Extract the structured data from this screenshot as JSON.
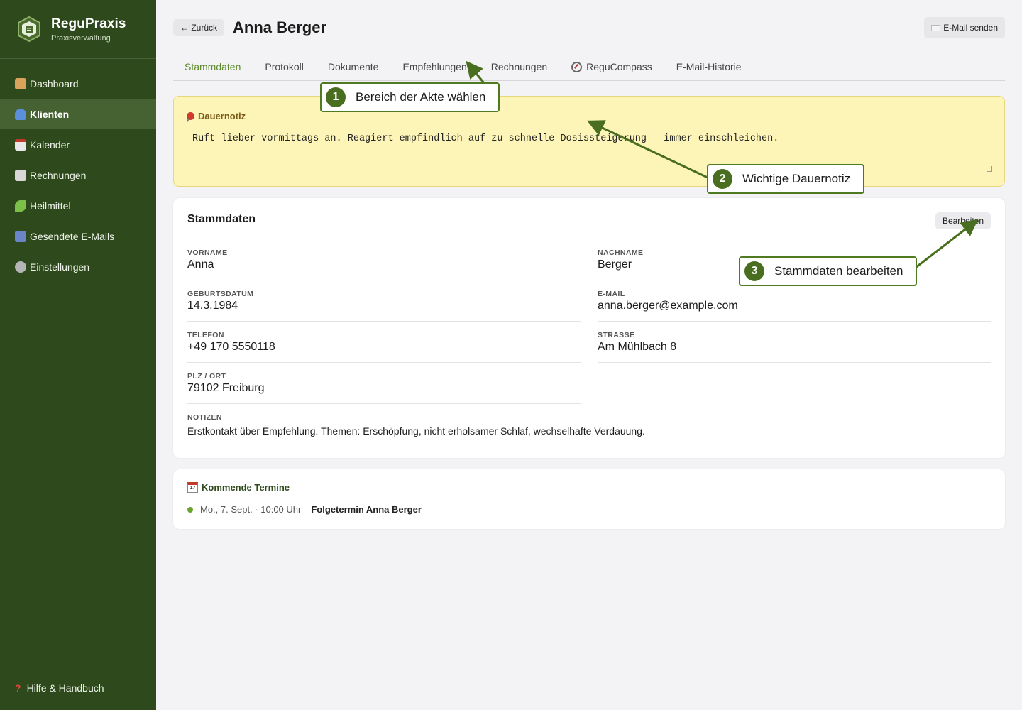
{
  "brand": {
    "title": "ReguPraxis",
    "subtitle": "Praxisverwaltung"
  },
  "sidebar": {
    "items": [
      {
        "label": "Dashboard",
        "icon": "house-icon"
      },
      {
        "label": "Klienten",
        "icon": "person-icon",
        "active": true
      },
      {
        "label": "Kalender",
        "icon": "calendar-icon"
      },
      {
        "label": "Rechnungen",
        "icon": "receipt-icon"
      },
      {
        "label": "Heilmittel",
        "icon": "herb-icon"
      },
      {
        "label": "Gesendete E-Mails",
        "icon": "mailbox-icon"
      },
      {
        "label": "Einstellungen",
        "icon": "gear-icon"
      }
    ],
    "footer": "Hilfe & Handbuch"
  },
  "header": {
    "back_label": "← Zurück",
    "title": "Anna Berger",
    "email_label": "E-Mail senden"
  },
  "tabs": [
    "Stammdaten",
    "Protokoll",
    "Dokumente",
    "Empfehlungen",
    "Rechnungen",
    "ReguCompass",
    "E-Mail-Historie"
  ],
  "note": {
    "title": "Dauernotiz",
    "text": "Ruft lieber vormittags an. Reagiert empfindlich auf zu schnelle Dosissteigerung – immer einschleichen."
  },
  "stamm": {
    "title": "Stammdaten",
    "edit_label": "Bearbeiten",
    "fields": {
      "vorname": {
        "label": "VORNAME",
        "value": "Anna"
      },
      "nachname": {
        "label": "NACHNAME",
        "value": "Berger"
      },
      "geburtsdatum": {
        "label": "GEBURTSDATUM",
        "value": "14.3.1984"
      },
      "email": {
        "label": "E-MAIL",
        "value": "anna.berger@example.com"
      },
      "telefon": {
        "label": "TELEFON",
        "value": "+49 170 5550118"
      },
      "strasse": {
        "label": "STRASSE",
        "value": "Am Mühlbach 8"
      },
      "plzort": {
        "label": "PLZ / ORT",
        "value": "79102 Freiburg"
      }
    },
    "notes_label": "NOTIZEN",
    "notes_value": "Erstkontakt über Empfehlung. Themen: Erschöpfung, nicht erholsamer Schlaf, wechselhafte Verdauung."
  },
  "termine": {
    "title": "Kommende Termine",
    "items": [
      {
        "date": "Mo., 7. Sept. · 10:00 Uhr",
        "name": "Folgetermin Anna Berger"
      }
    ]
  },
  "callouts": [
    {
      "num": "1",
      "text": "Bereich der Akte wählen"
    },
    {
      "num": "2",
      "text": "Wichtige Dauernotiz"
    },
    {
      "num": "3",
      "text": "Stammdaten bearbeiten"
    }
  ],
  "colors": {
    "sidebar": "#2e4a1c",
    "accent": "#5c8a2a",
    "note_bg": "#fdf5b8",
    "callout_border": "#4f7a22"
  }
}
